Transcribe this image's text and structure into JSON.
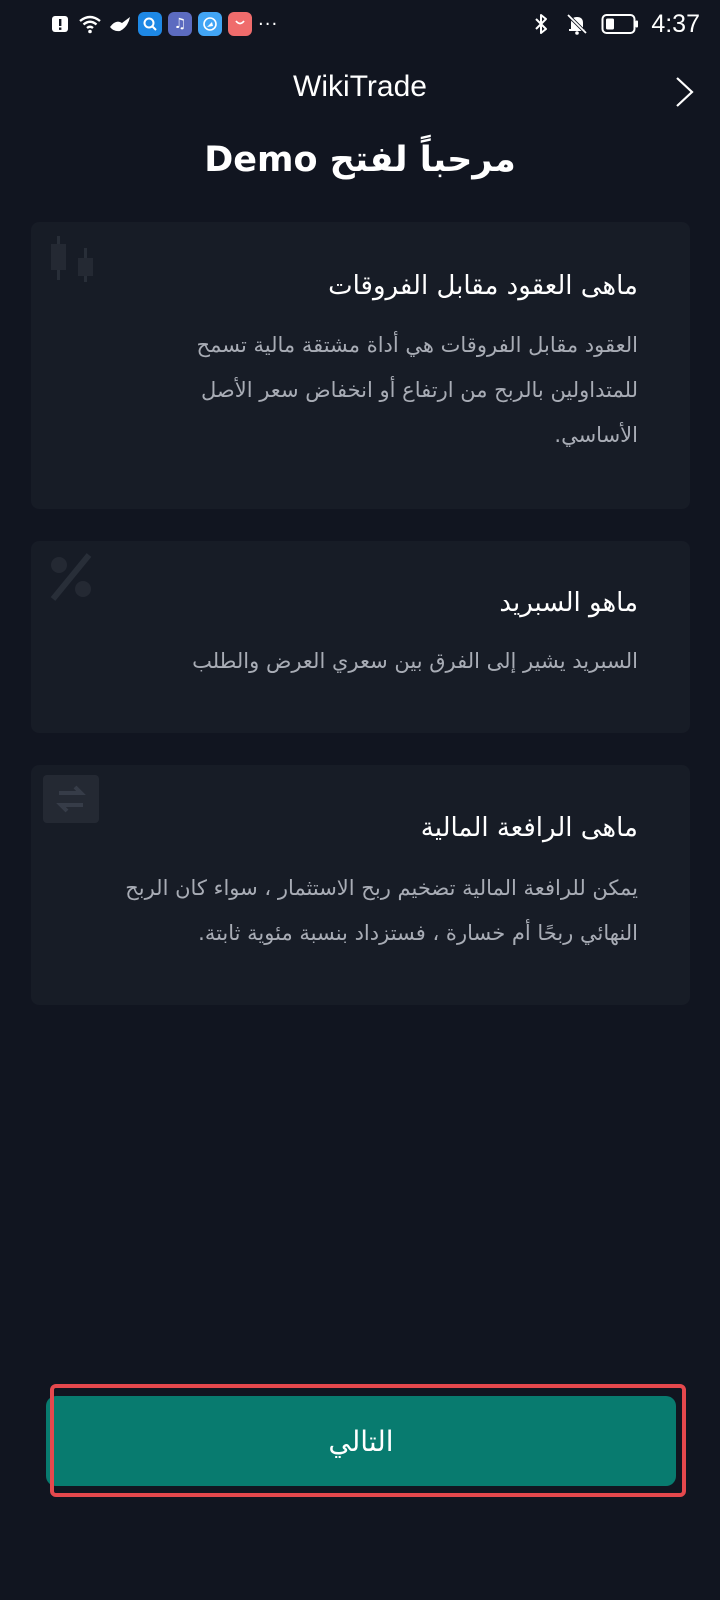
{
  "status_bar": {
    "time": "4:37",
    "more": "···",
    "left_icons": [
      "alert-icon",
      "wifi-icon",
      "app-bird-icon",
      "app-search-icon",
      "app-music-icon",
      "app-browser-icon",
      "app-shop-icon"
    ],
    "right_icons": [
      "bluetooth-icon",
      "bell-muted-icon",
      "battery-icon"
    ]
  },
  "header": {
    "app_name": "WikiTrade",
    "next_icon": "chevron-right-icon"
  },
  "page": {
    "title": "مرحباً لفتح Demo"
  },
  "cards": [
    {
      "icon": "candlestick-icon",
      "title": "ماهى العقود مقابل الفروقات",
      "lines": [
        "العقود مقابل الفروقات هي أداة مشتقة مالية تسمح",
        "للمتداولين بالربح من ارتفاع أو انخفاض سعر الأصل",
        "الأساسي."
      ]
    },
    {
      "icon": "percent-icon",
      "title": "ماهو السبريد",
      "lines": [
        "السبريد يشير إلى الفرق بين سعري العرض والطلب"
      ]
    },
    {
      "icon": "exchange-icon",
      "title": "ماهى الرافعة المالية",
      "lines": [
        "يمكن للرافعة المالية تضخيم ربح الاستثمار ، سواء كان الربح",
        "النهائي ربحًا أم خسارة ، فستزداد بنسبة مئوية ثابتة."
      ]
    }
  ],
  "footer": {
    "next_label": "التالي"
  },
  "colors": {
    "background": "#111520",
    "card": "#171c26",
    "accent": "#087b6f",
    "highlight_border": "#e5484d"
  }
}
